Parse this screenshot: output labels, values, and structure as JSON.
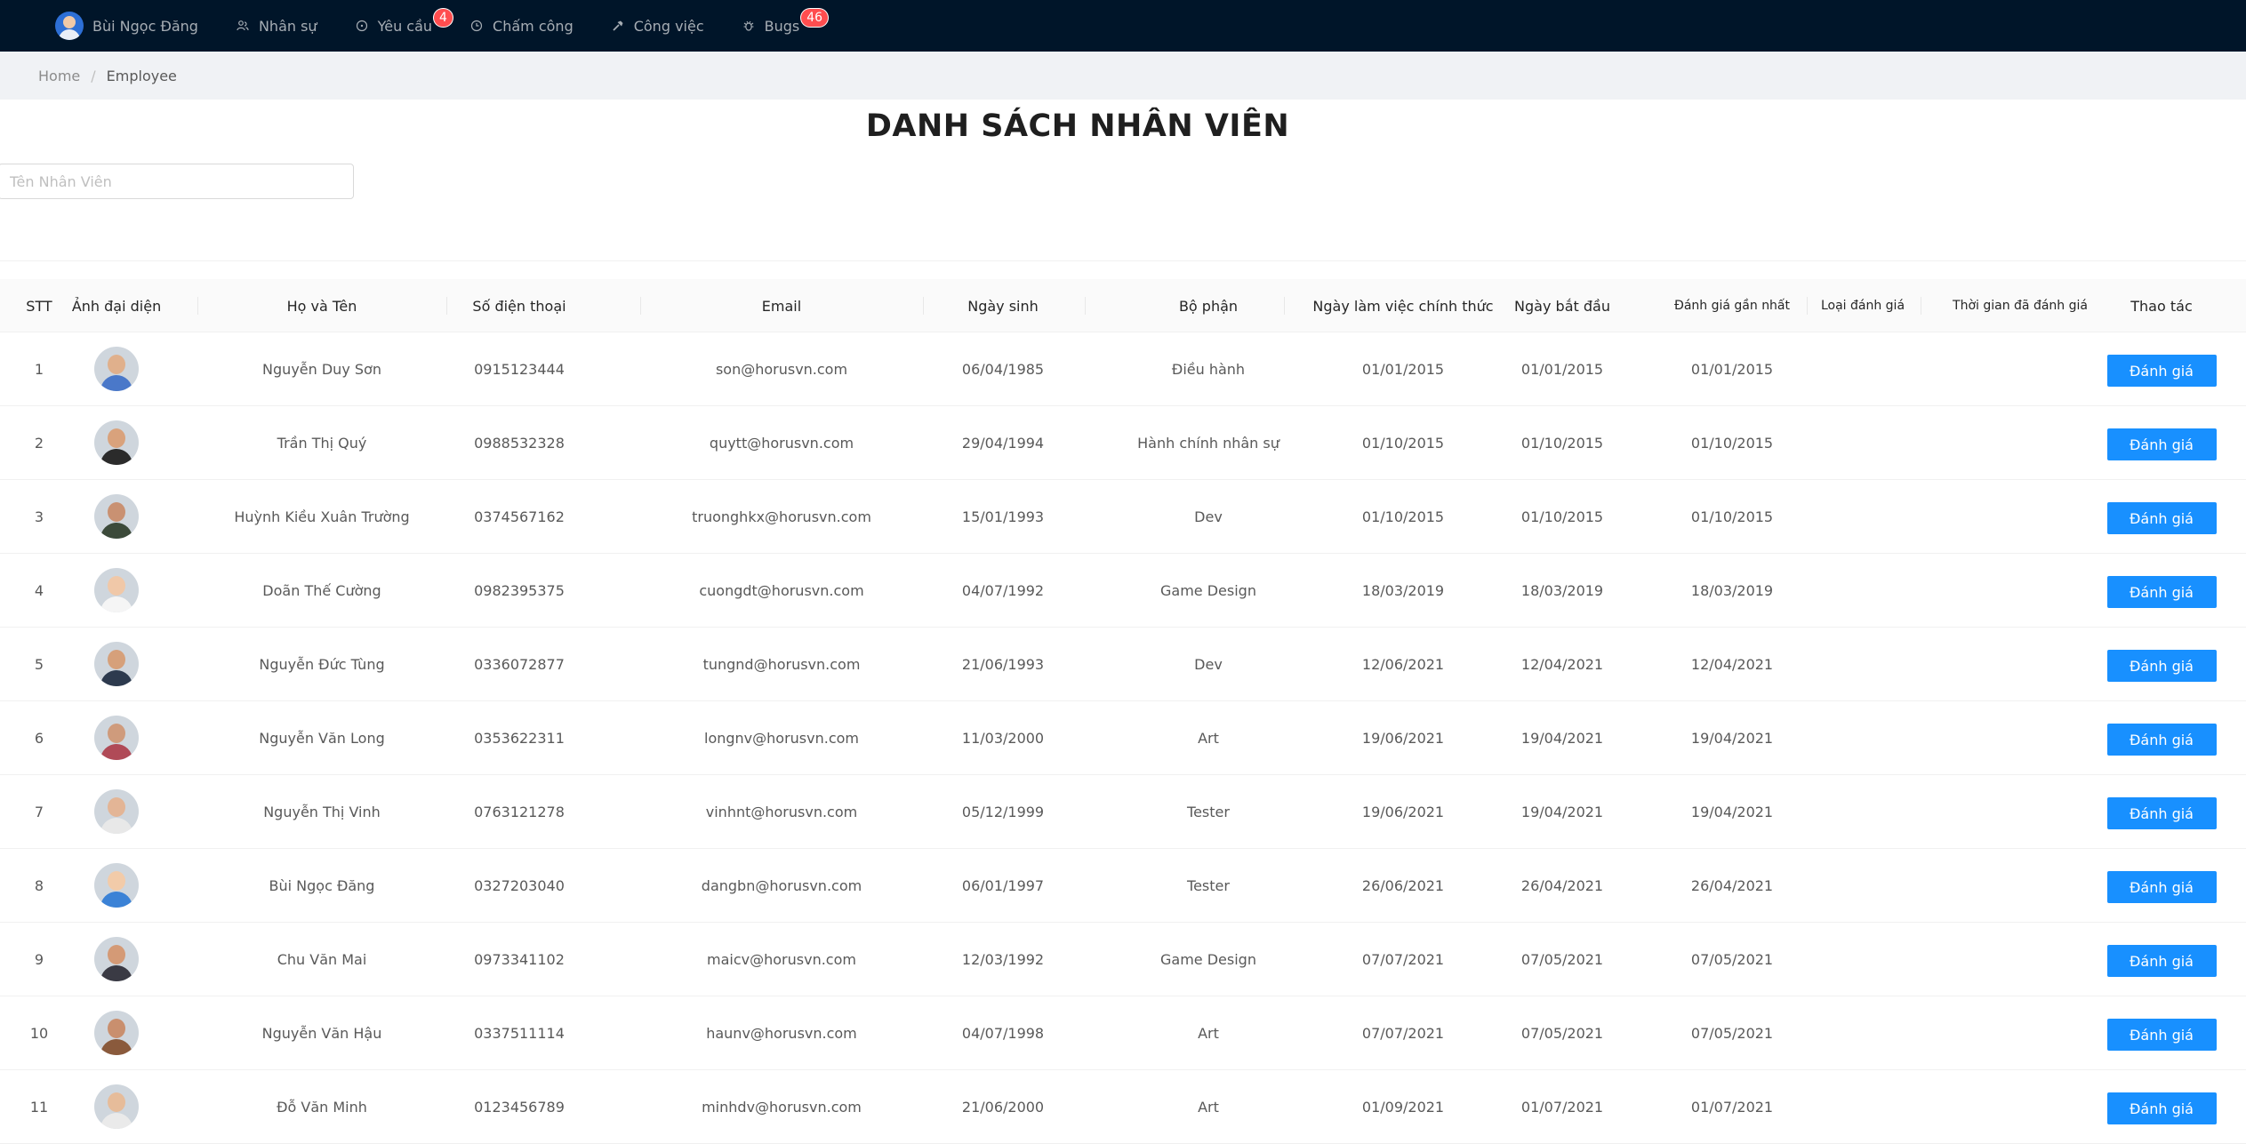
{
  "nav": {
    "user_name": "Bùi Ngọc Đăng",
    "items": [
      {
        "label": "Nhân sự",
        "icon": "user-group-icon"
      },
      {
        "label": "Yêu cầu",
        "icon": "request-icon",
        "badge": "4"
      },
      {
        "label": "Chấm công",
        "icon": "clock-icon"
      },
      {
        "label": "Công việc",
        "icon": "hammer-icon"
      },
      {
        "label": "Bugs",
        "icon": "bug-icon",
        "badge": "46"
      }
    ]
  },
  "breadcrumb": {
    "home": "Home",
    "separator": "/",
    "current": "Employee"
  },
  "title": "DANH SÁCH NHÂN VIÊN",
  "search": {
    "placeholder": "Tên Nhân Viên",
    "value": ""
  },
  "table": {
    "headers": [
      "STT",
      "Ảnh đại diện",
      "Họ và Tên",
      "Số điện thoại",
      "Email",
      "Ngày sinh",
      "Bộ phận",
      "Ngày làm việc chính thức",
      "Ngày bắt đầu",
      "Đánh giá gần nhất",
      "Loại đánh giá",
      "Thời gian đã đánh giá",
      "Thao tác"
    ],
    "action_label": "Đánh giá",
    "rows": [
      {
        "stt": "1",
        "name": "Nguyễn Duy Sơn",
        "phone": "0915123444",
        "email": "son@horusvn.com",
        "dob": "06/04/1985",
        "dept": "Điều hành",
        "official": "01/01/2015",
        "start": "01/01/2015",
        "last_review": "01/01/2015",
        "review_type": "",
        "review_time": ""
      },
      {
        "stt": "2",
        "name": "Trần Thị Quý",
        "phone": "0988532328",
        "email": "quytt@horusvn.com",
        "dob": "29/04/1994",
        "dept": "Hành chính nhân sự",
        "official": "01/10/2015",
        "start": "01/10/2015",
        "last_review": "01/10/2015",
        "review_type": "",
        "review_time": ""
      },
      {
        "stt": "3",
        "name": "Huỳnh Kiều Xuân Trường",
        "phone": "0374567162",
        "email": "truonghkx@horusvn.com",
        "dob": "15/01/1993",
        "dept": "Dev",
        "official": "01/10/2015",
        "start": "01/10/2015",
        "last_review": "01/10/2015",
        "review_type": "",
        "review_time": ""
      },
      {
        "stt": "4",
        "name": "Doãn Thế Cường",
        "phone": "0982395375",
        "email": "cuongdt@horusvn.com",
        "dob": "04/07/1992",
        "dept": "Game Design",
        "official": "18/03/2019",
        "start": "18/03/2019",
        "last_review": "18/03/2019",
        "review_type": "",
        "review_time": ""
      },
      {
        "stt": "5",
        "name": "Nguyễn Đức Tùng",
        "phone": "0336072877",
        "email": "tungnd@horusvn.com",
        "dob": "21/06/1993",
        "dept": "Dev",
        "official": "12/06/2021",
        "start": "12/04/2021",
        "last_review": "12/04/2021",
        "review_type": "",
        "review_time": ""
      },
      {
        "stt": "6",
        "name": "Nguyễn Văn Long",
        "phone": "0353622311",
        "email": "longnv@horusvn.com",
        "dob": "11/03/2000",
        "dept": "Art",
        "official": "19/06/2021",
        "start": "19/04/2021",
        "last_review": "19/04/2021",
        "review_type": "",
        "review_time": ""
      },
      {
        "stt": "7",
        "name": "Nguyễn Thị Vinh",
        "phone": "0763121278",
        "email": "vinhnt@horusvn.com",
        "dob": "05/12/1999",
        "dept": "Tester",
        "official": "19/06/2021",
        "start": "19/04/2021",
        "last_review": "19/04/2021",
        "review_type": "",
        "review_time": ""
      },
      {
        "stt": "8",
        "name": "Bùi Ngọc Đăng",
        "phone": "0327203040",
        "email": "dangbn@horusvn.com",
        "dob": "06/01/1997",
        "dept": "Tester",
        "official": "26/06/2021",
        "start": "26/04/2021",
        "last_review": "26/04/2021",
        "review_type": "",
        "review_time": ""
      },
      {
        "stt": "9",
        "name": "Chu Văn Mai",
        "phone": "0973341102",
        "email": "maicv@horusvn.com",
        "dob": "12/03/1992",
        "dept": "Game Design",
        "official": "07/07/2021",
        "start": "07/05/2021",
        "last_review": "07/05/2021",
        "review_type": "",
        "review_time": ""
      },
      {
        "stt": "10",
        "name": "Nguyễn Văn Hậu",
        "phone": "0337511114",
        "email": "haunv@horusvn.com",
        "dob": "04/07/1998",
        "dept": "Art",
        "official": "07/07/2021",
        "start": "07/05/2021",
        "last_review": "07/05/2021",
        "review_type": "",
        "review_time": ""
      },
      {
        "stt": "11",
        "name": "Đỗ Văn Minh",
        "phone": "0123456789",
        "email": "minhdv@horusvn.com",
        "dob": "21/06/2000",
        "dept": "Art",
        "official": "01/09/2021",
        "start": "01/07/2021",
        "last_review": "01/07/2021",
        "review_type": "",
        "review_time": ""
      }
    ]
  },
  "colors": {
    "navbar": "#001529",
    "primary": "#1890ff",
    "badge": "#ff4d4f"
  }
}
